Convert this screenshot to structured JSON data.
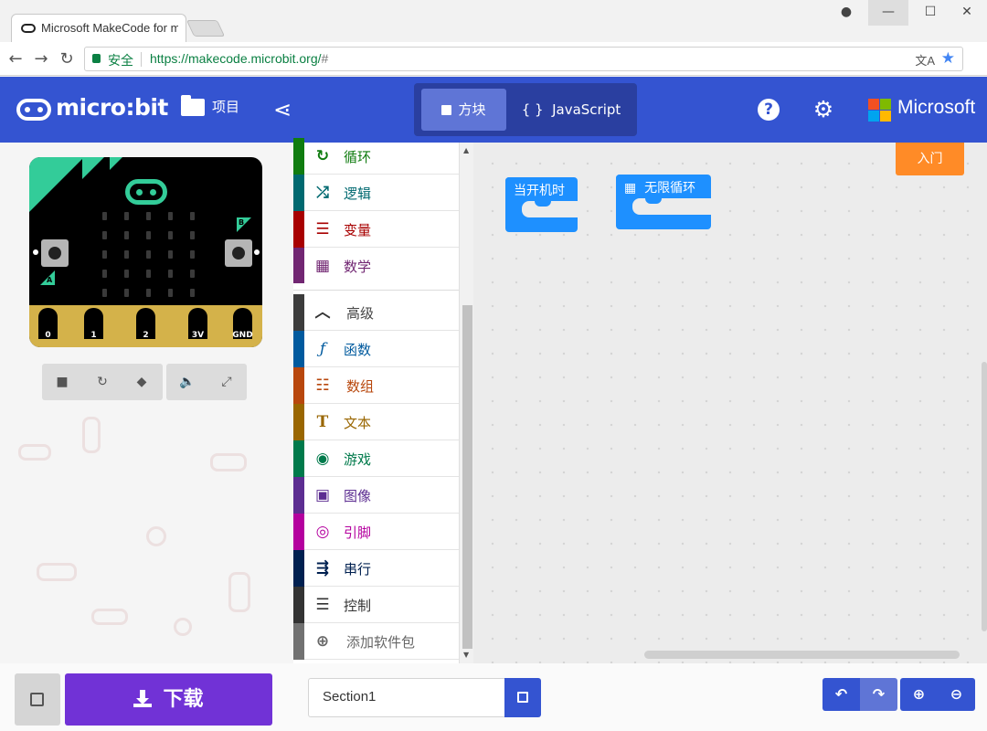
{
  "browser": {
    "tab_title": "Microsoft MakeCode for micro:bit",
    "secure_label": "安全",
    "url": "https://makecode.microbit.org/",
    "url_hash": "#"
  },
  "header": {
    "logo_text": "micro:bit",
    "projects_label": "项目",
    "blocks_label": "方块",
    "javascript_label": "JavaScript",
    "microsoft_label": "Microsoft"
  },
  "simulator": {
    "pins": [
      "0",
      "1",
      "2",
      "3V",
      "GND"
    ],
    "button_a": "A",
    "button_b": "B"
  },
  "toolbox": {
    "items": [
      {
        "label": "循环",
        "color": "#107c10",
        "icon": "loop-icon"
      },
      {
        "label": "逻辑",
        "color": "#006970",
        "icon": "shuffle-icon"
      },
      {
        "label": "变量",
        "color": "#a80000",
        "icon": "list-icon"
      },
      {
        "label": "数学",
        "color": "#712672",
        "icon": "calculator-icon"
      },
      {
        "label": "高级",
        "color": "#3c3c3c",
        "icon": "chevron-up-icon"
      },
      {
        "label": "函数",
        "color": "#005a9e",
        "icon": "function-icon"
      },
      {
        "label": "数组",
        "color": "#b8470c",
        "icon": "list-ol-icon"
      },
      {
        "label": "文本",
        "color": "#996600",
        "icon": "text-icon"
      },
      {
        "label": "游戏",
        "color": "#007a4b",
        "icon": "gamepad-icon"
      },
      {
        "label": "图像",
        "color": "#5c2d91",
        "icon": "image-icon"
      },
      {
        "label": "引脚",
        "color": "#b4009e",
        "icon": "target-icon"
      },
      {
        "label": "串行",
        "color": "#002050",
        "icon": "usb-icon"
      },
      {
        "label": "控制",
        "color": "#333333",
        "icon": "server-icon"
      },
      {
        "label": "添加软件包",
        "color": "#717171",
        "icon": "plus-circle-icon"
      }
    ]
  },
  "workspace": {
    "getting_started": "入门",
    "on_start": "当开机时",
    "forever": "无限循环"
  },
  "bottom": {
    "download_label": "下载",
    "project_name": "Section1"
  }
}
